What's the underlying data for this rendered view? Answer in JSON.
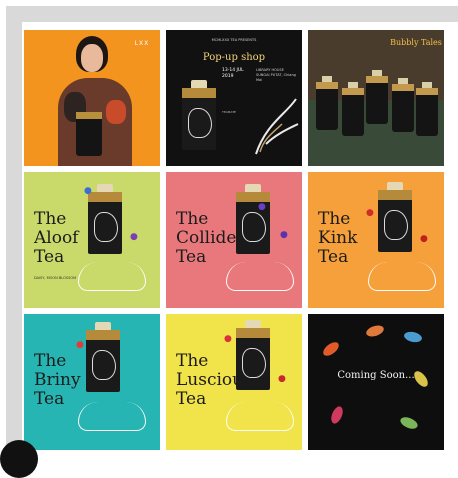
{
  "posts": [
    {
      "id": "portrait",
      "logo": "LXX"
    },
    {
      "id": "popup",
      "kicker": "MCMLXXX TEA PRESENTS",
      "title": "Pop-up shop",
      "date": "13-14 JUL 2019",
      "venue": "LIBRARY HOUSE SUNGAI PUTAT, Chiang Mai",
      "body": "TEAMATE"
    },
    {
      "id": "bubbly",
      "title": "Bubbly Tales"
    },
    {
      "id": "aloof",
      "title": "The Aloof Tea",
      "small": "DAISY, MOON BLOSSOM",
      "color": "#c9da6a"
    },
    {
      "id": "collide",
      "title": "The Collide Tea",
      "small": "",
      "color": "#e8787b"
    },
    {
      "id": "kink",
      "title": "The Kink Tea",
      "small": "",
      "color": "#f5a03a"
    },
    {
      "id": "briny",
      "title": "The Briny Tea",
      "small": "",
      "color": "#27b5b3"
    },
    {
      "id": "luscious",
      "title": "The Luscious Tea",
      "small": "",
      "color": "#f1e34a"
    },
    {
      "id": "coming",
      "kicker": "",
      "title": "Coming Soon..."
    }
  ]
}
